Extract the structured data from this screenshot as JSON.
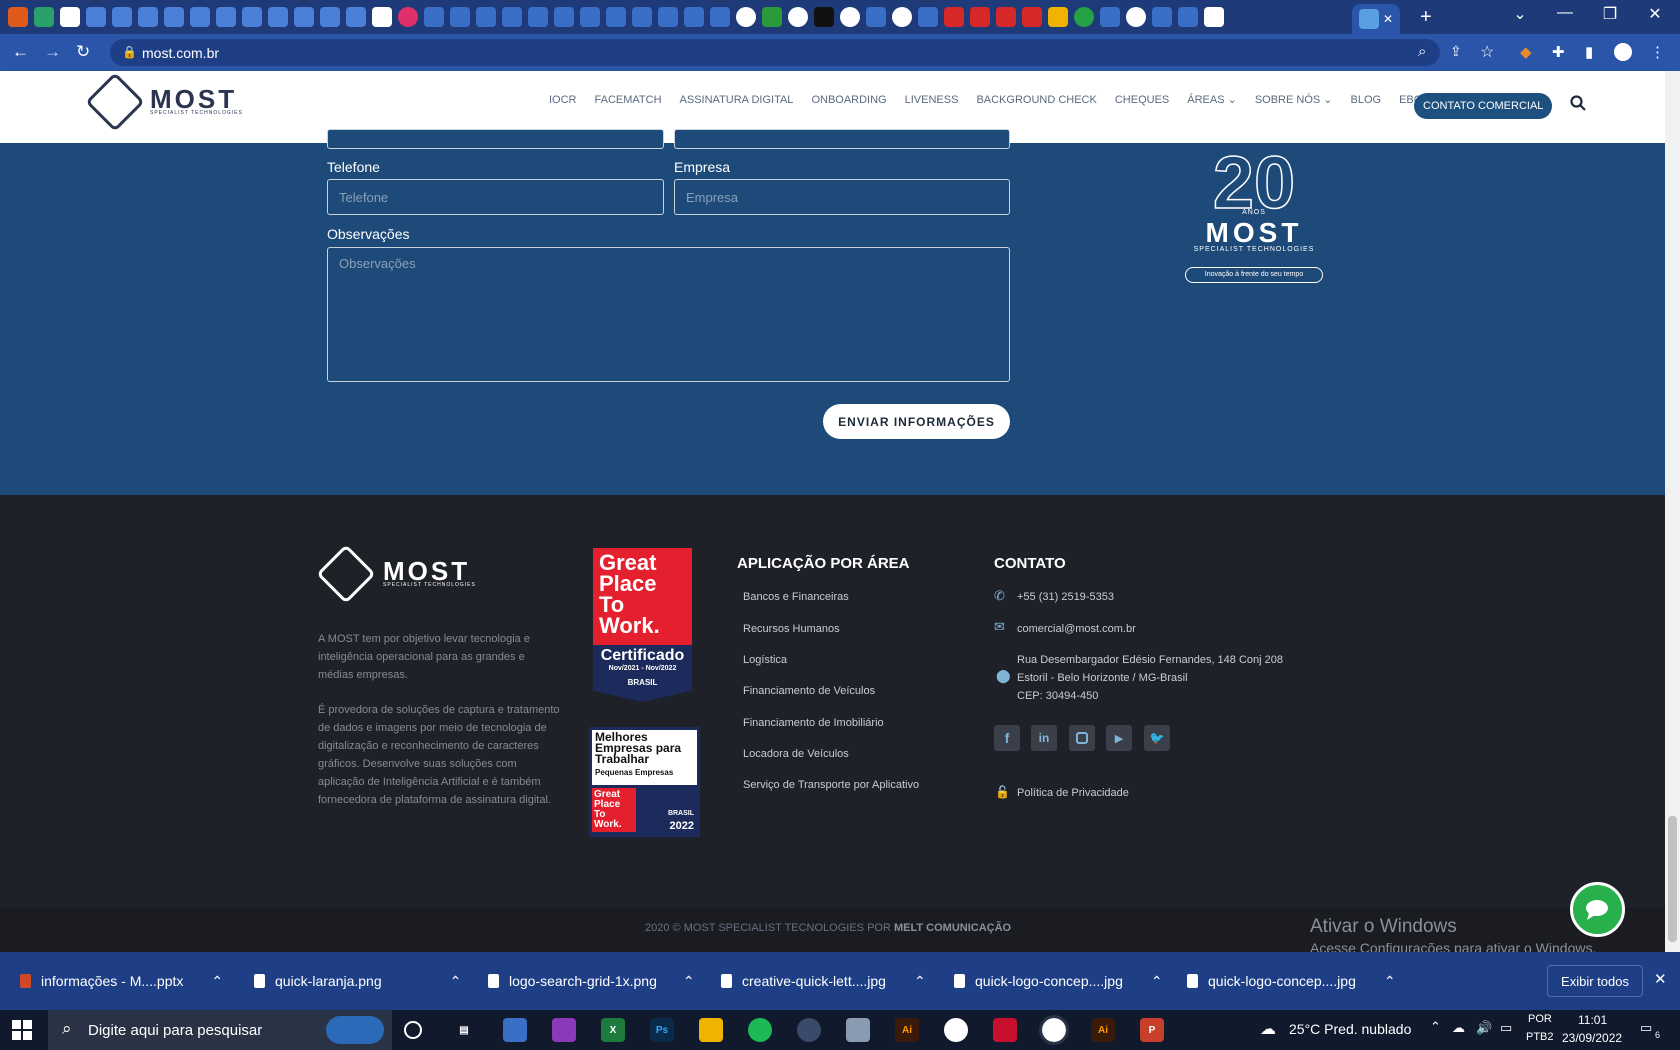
{
  "browser": {
    "url": "most.com.br",
    "active_tab_close": "✕",
    "new_tab": "+"
  },
  "header": {
    "logo_text": "MOST",
    "logo_sub": "SPECIALIST TECHNOLOGIES",
    "nav": [
      "IOCR",
      "FACEMATCH",
      "ASSINATURA DIGITAL",
      "ONBOARDING",
      "LIVENESS",
      "BACKGROUND CHECK",
      "CHEQUES",
      "ÁREAS",
      "SOBRE NÓS",
      "BLOG",
      "EBOOK"
    ],
    "cta": "CONTATO COMERCIAL"
  },
  "form": {
    "telefone_label": "Telefone",
    "telefone_placeholder": "Telefone",
    "empresa_label": "Empresa",
    "empresa_placeholder": "Empresa",
    "obs_label": "Observações",
    "obs_placeholder": "Observações",
    "submit": "ENVIAR INFORMAÇÕES"
  },
  "badge": {
    "number": "20",
    "anos": "ANOS",
    "name": "MOST",
    "sub": "SPECIALIST TECHNOLOGIES",
    "tagline": "Inovação à frente do seu tempo"
  },
  "footer": {
    "about1": "A MOST tem por objetivo levar tecnologia e inteligência operacional para as grandes e médias empresas.",
    "about2": "É provedora de soluções de captura e tratamento de dados e imagens por meio de tecnologia de digitalização e reconhecimento de caracteres gráficos. Desenvolve suas soluções com aplicação de Inteligência Artificial e é também fornecedora de plataforma de assinatura digital.",
    "gptw": {
      "line1": "Great",
      "line2": "Place",
      "line3": "To",
      "line4": "Work.",
      "cert": "Certificado",
      "period": "Nov/2021 - Nov/2022",
      "country": "BRASIL"
    },
    "gptw2": {
      "title": "Melhores Empresas para Trabalhar",
      "sub": "Pequenas Empresas",
      "gp": "Great Place To Work.",
      "country": "BRASIL",
      "year": "2022"
    },
    "areas_title": "APLICAÇÃO POR ÁREA",
    "areas": [
      "Bancos e Financeiras",
      "Recursos Humanos",
      "Logística",
      "Financiamento de Veículos",
      "Financiamento de Imobiliário",
      "Locadora de Veículos",
      "Serviço de Transporte por Aplicativo"
    ],
    "contato_title": "CONTATO",
    "phone": "+55 (31) 2519-5353",
    "email": "comercial@most.com.br",
    "address1": "Rua Desembargador Edésio Fernandes, 148 Conj 208",
    "address2": "Estoril - Belo Horizonte / MG-Brasil",
    "address3": "CEP: 30494-450",
    "privacy": "Política de Privacidade",
    "copyright": "2020 © MOST SPECIALIST TECNOLOGIES POR",
    "copyright_brand": "MELT COMUNICAÇÃO",
    "activate_title": "Ativar o Windows",
    "activate_sub": "Acesse Configurações para ativar o Windows."
  },
  "downloads": {
    "items": [
      "informações - M....pptx",
      "quick-laranja.png",
      "logo-search-grid-1x.png",
      "creative-quick-lett....jpg",
      "quick-logo-concep....jpg",
      "quick-logo-concep....jpg"
    ],
    "show_all": "Exibir todos",
    "close": "✕"
  },
  "taskbar": {
    "search_placeholder": "Digite aqui para pesquisar",
    "weather": "25°C  Pred. nublado",
    "lang1": "POR",
    "lang2": "PTB2",
    "time": "11:01",
    "date": "23/09/2022",
    "notif": "6"
  },
  "colors": {
    "header_nav_cta": "#1d4f7f",
    "form_bg": "#1d4a78",
    "footer_bg": "#1f2128",
    "gptw_red": "#e5202e",
    "gptw_navy": "#1d2a5c",
    "whatsapp_green": "#27b04c"
  }
}
